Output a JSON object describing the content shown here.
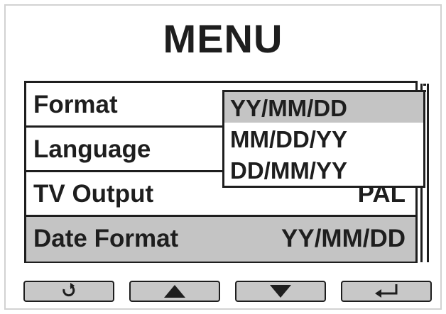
{
  "screen": {
    "title": "MENU"
  },
  "menu": {
    "items": [
      {
        "label": "Format",
        "value": ""
      },
      {
        "label": "Language",
        "value": ""
      },
      {
        "label": "TV Output",
        "value": "PAL"
      },
      {
        "label": "Date Format",
        "value": "YY/MM/DD",
        "selected": true
      }
    ]
  },
  "dropdown": {
    "options": [
      "YY/MM/DD",
      "MM/DD/YY",
      "DD/MM/YY"
    ],
    "highlighted": "YY/MM/DD"
  },
  "buttons": [
    {
      "icon": "rotate-back-icon"
    },
    {
      "icon": "up-arrow-icon"
    },
    {
      "icon": "down-arrow-icon"
    },
    {
      "icon": "enter-return-icon"
    }
  ],
  "colors": {
    "text": "#1e1e1e",
    "selection": "#c4c4c4",
    "button_fill": "#c8c8c8",
    "frame": "#d2d2d2"
  }
}
